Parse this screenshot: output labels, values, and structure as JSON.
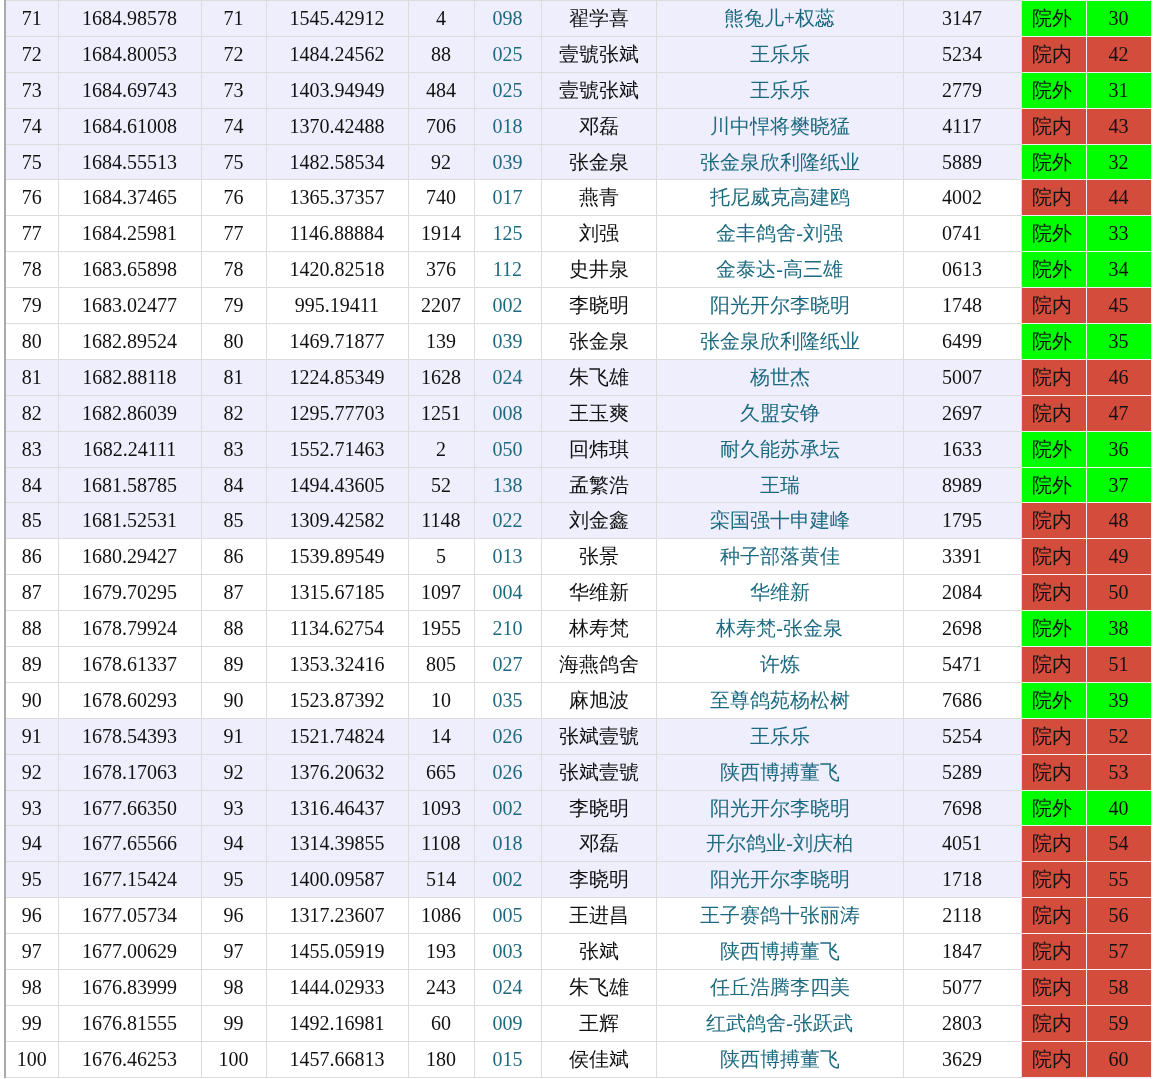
{
  "table": {
    "rows": [
      {
        "shaded": true,
        "cells": [
          "71",
          "1684.98578",
          "71",
          "1545.42912",
          "4",
          "098",
          "翟学喜",
          "熊兔儿+权蕊",
          "3147"
        ],
        "status": "院外",
        "status_count": "30",
        "color": "#00ff00"
      },
      {
        "shaded": true,
        "cells": [
          "72",
          "1684.80053",
          "72",
          "1484.24562",
          "88",
          "025",
          "壹號张斌",
          "王乐乐",
          "5234"
        ],
        "status": "院内",
        "status_count": "42",
        "color": "#d44c3c"
      },
      {
        "shaded": true,
        "cells": [
          "73",
          "1684.69743",
          "73",
          "1403.94949",
          "484",
          "025",
          "壹號张斌",
          "王乐乐",
          "2779"
        ],
        "status": "院外",
        "status_count": "31",
        "color": "#00ff00"
      },
      {
        "shaded": true,
        "cells": [
          "74",
          "1684.61008",
          "74",
          "1370.42488",
          "706",
          "018",
          "邓磊",
          "川中悍将樊晓猛",
          "4117"
        ],
        "status": "院内",
        "status_count": "43",
        "color": "#d44c3c"
      },
      {
        "shaded": true,
        "cells": [
          "75",
          "1684.55513",
          "75",
          "1482.58534",
          "92",
          "039",
          "张金泉",
          "张金泉欣利隆纸业",
          "5889"
        ],
        "status": "院外",
        "status_count": "32",
        "color": "#00ff00"
      },
      {
        "shaded": false,
        "cells": [
          "76",
          "1684.37465",
          "76",
          "1365.37357",
          "740",
          "017",
          "燕青",
          "托尼威克高建鸥",
          "4002"
        ],
        "status": "院内",
        "status_count": "44",
        "color": "#d44c3c"
      },
      {
        "shaded": false,
        "cells": [
          "77",
          "1684.25981",
          "77",
          "1146.88884",
          "1914",
          "125",
          "刘强",
          "金丰鸽舍-刘强",
          "0741"
        ],
        "status": "院外",
        "status_count": "33",
        "color": "#00ff00"
      },
      {
        "shaded": false,
        "cells": [
          "78",
          "1683.65898",
          "78",
          "1420.82518",
          "376",
          "112",
          "史井泉",
          "金泰达-高三雄",
          "0613"
        ],
        "status": "院外",
        "status_count": "34",
        "color": "#00ff00"
      },
      {
        "shaded": false,
        "cells": [
          "79",
          "1683.02477",
          "79",
          "995.19411",
          "2207",
          "002",
          "李晓明",
          "阳光开尔李晓明",
          "1748"
        ],
        "status": "院内",
        "status_count": "45",
        "color": "#d44c3c"
      },
      {
        "shaded": false,
        "cells": [
          "80",
          "1682.89524",
          "80",
          "1469.71877",
          "139",
          "039",
          "张金泉",
          "张金泉欣利隆纸业",
          "6499"
        ],
        "status": "院外",
        "status_count": "35",
        "color": "#00ff00"
      },
      {
        "shaded": true,
        "cells": [
          "81",
          "1682.88118",
          "81",
          "1224.85349",
          "1628",
          "024",
          "朱飞雄",
          "杨世杰",
          "5007"
        ],
        "status": "院内",
        "status_count": "46",
        "color": "#d44c3c"
      },
      {
        "shaded": true,
        "cells": [
          "82",
          "1682.86039",
          "82",
          "1295.77703",
          "1251",
          "008",
          "王玉爽",
          "久盟安铮",
          "2697"
        ],
        "status": "院内",
        "status_count": "47",
        "color": "#d44c3c"
      },
      {
        "shaded": true,
        "cells": [
          "83",
          "1682.24111",
          "83",
          "1552.71463",
          "2",
          "050",
          "回炜琪",
          "耐久能苏承坛",
          "1633"
        ],
        "status": "院外",
        "status_count": "36",
        "color": "#00ff00"
      },
      {
        "shaded": true,
        "cells": [
          "84",
          "1681.58785",
          "84",
          "1494.43605",
          "52",
          "138",
          "孟繁浩",
          "王瑞",
          "8989"
        ],
        "status": "院外",
        "status_count": "37",
        "color": "#00ff00"
      },
      {
        "shaded": true,
        "cells": [
          "85",
          "1681.52531",
          "85",
          "1309.42582",
          "1148",
          "022",
          "刘金鑫",
          "栾国强十申建峰",
          "1795"
        ],
        "status": "院内",
        "status_count": "48",
        "color": "#d44c3c"
      },
      {
        "shaded": false,
        "cells": [
          "86",
          "1680.29427",
          "86",
          "1539.89549",
          "5",
          "013",
          "张景",
          "种子部落黄佳",
          "3391"
        ],
        "status": "院内",
        "status_count": "49",
        "color": "#d44c3c"
      },
      {
        "shaded": false,
        "cells": [
          "87",
          "1679.70295",
          "87",
          "1315.67185",
          "1097",
          "004",
          "华维新",
          "华维新",
          "2084"
        ],
        "status": "院内",
        "status_count": "50",
        "color": "#d44c3c"
      },
      {
        "shaded": false,
        "cells": [
          "88",
          "1678.79924",
          "88",
          "1134.62754",
          "1955",
          "210",
          "林寿梵",
          "林寿梵-张金泉",
          "2698"
        ],
        "status": "院外",
        "status_count": "38",
        "color": "#00ff00"
      },
      {
        "shaded": false,
        "cells": [
          "89",
          "1678.61337",
          "89",
          "1353.32416",
          "805",
          "027",
          "海燕鸽舍",
          "许炼",
          "5471"
        ],
        "status": "院内",
        "status_count": "51",
        "color": "#d44c3c"
      },
      {
        "shaded": false,
        "cells": [
          "90",
          "1678.60293",
          "90",
          "1523.87392",
          "10",
          "035",
          "麻旭波",
          "至尊鸽苑杨松树",
          "7686"
        ],
        "status": "院外",
        "status_count": "39",
        "color": "#00ff00"
      },
      {
        "shaded": true,
        "cells": [
          "91",
          "1678.54393",
          "91",
          "1521.74824",
          "14",
          "026",
          "张斌壹號",
          "王乐乐",
          "5254"
        ],
        "status": "院内",
        "status_count": "52",
        "color": "#d44c3c"
      },
      {
        "shaded": true,
        "cells": [
          "92",
          "1678.17063",
          "92",
          "1376.20632",
          "665",
          "026",
          "张斌壹號",
          "陕西博搏董飞",
          "5289"
        ],
        "status": "院内",
        "status_count": "53",
        "color": "#d44c3c"
      },
      {
        "shaded": true,
        "cells": [
          "93",
          "1677.66350",
          "93",
          "1316.46437",
          "1093",
          "002",
          "李晓明",
          "阳光开尔李晓明",
          "7698"
        ],
        "status": "院外",
        "status_count": "40",
        "color": "#00ff00"
      },
      {
        "shaded": true,
        "cells": [
          "94",
          "1677.65566",
          "94",
          "1314.39855",
          "1108",
          "018",
          "邓磊",
          "开尔鸽业-刘庆柏",
          "4051"
        ],
        "status": "院内",
        "status_count": "54",
        "color": "#d44c3c"
      },
      {
        "shaded": true,
        "cells": [
          "95",
          "1677.15424",
          "95",
          "1400.09587",
          "514",
          "002",
          "李晓明",
          "阳光开尔李晓明",
          "1718"
        ],
        "status": "院内",
        "status_count": "55",
        "color": "#d44c3c"
      },
      {
        "shaded": false,
        "cells": [
          "96",
          "1677.05734",
          "96",
          "1317.23607",
          "1086",
          "005",
          "王进昌",
          "王子赛鸽十张丽涛",
          "2118"
        ],
        "status": "院内",
        "status_count": "56",
        "color": "#d44c3c"
      },
      {
        "shaded": false,
        "cells": [
          "97",
          "1677.00629",
          "97",
          "1455.05919",
          "193",
          "003",
          "张斌",
          "陕西博搏董飞",
          "1847"
        ],
        "status": "院内",
        "status_count": "57",
        "color": "#d44c3c"
      },
      {
        "shaded": false,
        "cells": [
          "98",
          "1676.83999",
          "98",
          "1444.02933",
          "243",
          "024",
          "朱飞雄",
          "任丘浩腾李四美",
          "5077"
        ],
        "status": "院内",
        "status_count": "58",
        "color": "#d44c3c"
      },
      {
        "shaded": false,
        "cells": [
          "99",
          "1676.81555",
          "99",
          "1492.16981",
          "60",
          "009",
          "王辉",
          "红武鸽舍-张跃武",
          "2803"
        ],
        "status": "院内",
        "status_count": "59",
        "color": "#d44c3c"
      },
      {
        "shaded": false,
        "cells": [
          "100",
          "1676.46253",
          "100",
          "1457.66813",
          "180",
          "015",
          "侯佳斌",
          "陕西博搏董飞",
          "3629"
        ],
        "status": "院内",
        "status_count": "60",
        "color": "#d44c3c"
      }
    ]
  }
}
